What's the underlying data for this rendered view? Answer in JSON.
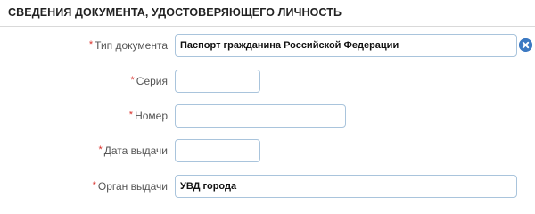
{
  "section": {
    "title": "СВЕДЕНИЯ ДОКУМЕНТА, УДОСТОВЕРЯЮЩЕГО ЛИЧНОСТЬ"
  },
  "form": {
    "required_marker": "*",
    "doc_type": {
      "label": "Тип документа",
      "value": "Паспорт гражданина Российской Федерации"
    },
    "series": {
      "label": "Серия",
      "value": ""
    },
    "number": {
      "label": "Номер",
      "value": ""
    },
    "issue_date": {
      "label": "Дата выдачи",
      "value": ""
    },
    "issuer": {
      "label": "Орган выдачи",
      "value": "УВД города"
    }
  },
  "icons": {
    "clear": "close-circle-icon"
  },
  "colors": {
    "required": "#d9312b",
    "field_border": "#a9c4dc",
    "clear_button": "#3c79c2"
  }
}
